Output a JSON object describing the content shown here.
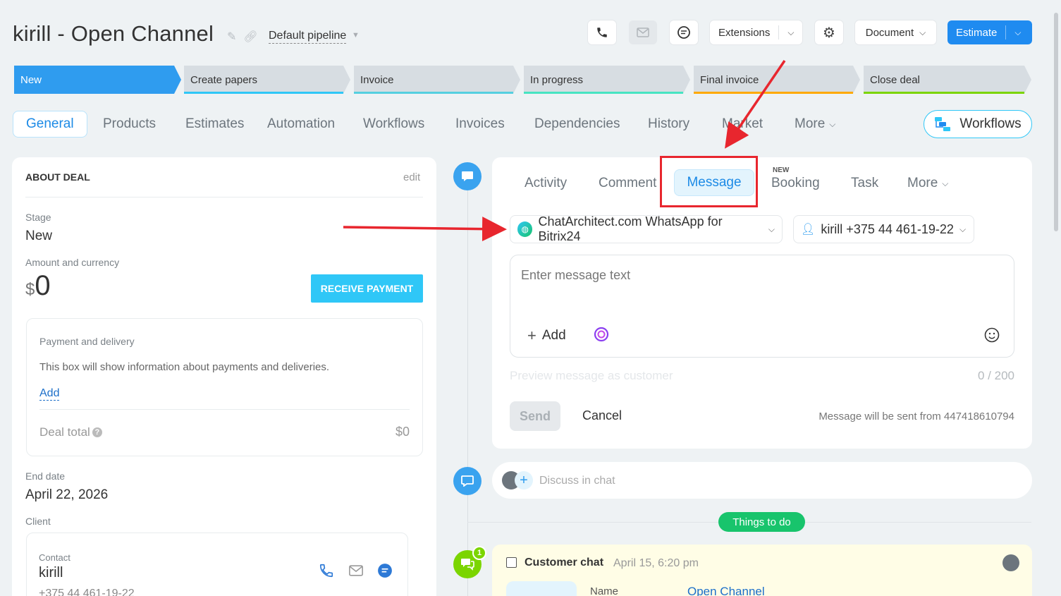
{
  "header": {
    "title": "kirill - Open Channel",
    "pipeline": "Default pipeline",
    "extensions": "Extensions",
    "document": "Document",
    "estimate": "Estimate"
  },
  "stages": [
    {
      "label": "New",
      "color": "#2f9cef"
    },
    {
      "label": "Create papers",
      "color": "#2fc7f7"
    },
    {
      "label": "Invoice",
      "color": "#55d0e0"
    },
    {
      "label": "In progress",
      "color": "#47e4c2"
    },
    {
      "label": "Final invoice",
      "color": "#ffa900"
    },
    {
      "label": "Close deal",
      "color": "#7bd500"
    }
  ],
  "tabs": [
    "General",
    "Products",
    "Estimates",
    "Automation",
    "Workflows",
    "Invoices",
    "Dependencies",
    "History",
    "Market",
    "More"
  ],
  "workflows_button": "Workflows",
  "about": {
    "heading": "ABOUT DEAL",
    "edit": "edit",
    "stage_label": "Stage",
    "stage_value": "New",
    "amount_label": "Amount and currency",
    "currency": "$",
    "amount": "0",
    "receive_payment": "RECEIVE PAYMENT",
    "payment_title": "Payment and delivery",
    "payment_desc": "This box will show information about payments and deliveries.",
    "payment_add": "Add",
    "deal_total_label": "Deal total",
    "deal_total_value": "$0",
    "end_date_label": "End date",
    "end_date_value": "April 22, 2026",
    "client_label": "Client",
    "contact_label": "Contact",
    "contact_name": "kirill",
    "contact_phone": "+375 44 461-19-22"
  },
  "editor": {
    "tabs": {
      "activity": "Activity",
      "comment": "Comment",
      "message": "Message",
      "booking": "Booking",
      "booking_badge": "NEW",
      "task": "Task",
      "more": "More"
    },
    "channel": "ChatArchitect.com WhatsApp for Bitrix24",
    "recipient": "kirill +375 44 461-19-22",
    "placeholder": "Enter message text",
    "add": "Add",
    "preview": "Preview message as customer",
    "counter": "0 / 200",
    "send": "Send",
    "cancel": "Cancel",
    "sent_from": "Message will be sent from 447418610794"
  },
  "timeline": {
    "discuss": "Discuss in chat",
    "things_to_do": "Things to do",
    "customer_chat_title": "Customer chat",
    "customer_chat_time": "April 15, 6:20 pm",
    "badge": "1",
    "name_label": "Name",
    "name_value": "Open Channel"
  }
}
